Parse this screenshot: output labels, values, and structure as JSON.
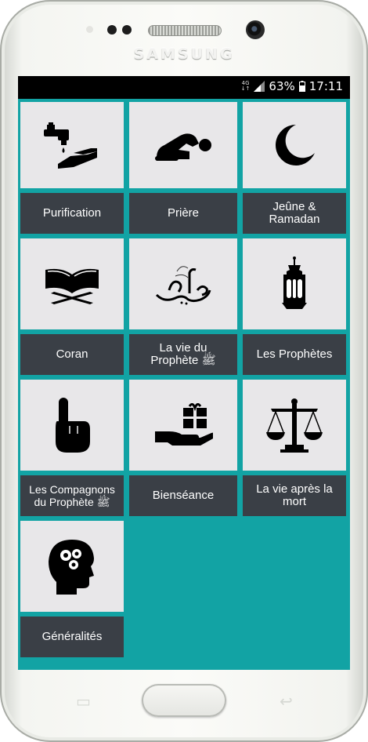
{
  "device": {
    "brand": "SAMSUNG"
  },
  "statusbar": {
    "network": "4G",
    "battery": "63%",
    "time": "17:11"
  },
  "categories": [
    {
      "label_lines": [
        "Purification"
      ],
      "icon": "water-hands-icon"
    },
    {
      "label_lines": [
        "Prière"
      ],
      "icon": "prostration-icon"
    },
    {
      "label_lines": [
        "Jeûne &",
        "Ramadan"
      ],
      "icon": "crescent-moon-icon"
    },
    {
      "label_lines": [
        "Coran"
      ],
      "icon": "quran-book-icon"
    },
    {
      "label_lines": [
        "La vie du",
        "Prophète ﷺ"
      ],
      "icon": "muhammad-calligraphy-icon"
    },
    {
      "label_lines": [
        "Les Prophètes"
      ],
      "icon": "lantern-icon"
    },
    {
      "label_lines": [
        "Les Compagnons",
        "du Prophète ﷺ"
      ],
      "icon": "raised-finger-icon"
    },
    {
      "label_lines": [
        "Bienséance"
      ],
      "icon": "gift-hand-icon"
    },
    {
      "label_lines": [
        "La vie après la",
        "mort"
      ],
      "icon": "scales-icon"
    },
    {
      "label_lines": [
        "Généralités"
      ],
      "icon": "head-gears-icon"
    }
  ],
  "colors": {
    "background": "#12a3a4",
    "tile": "#e8e7e9",
    "label_bar": "#3a3f46",
    "label_text": "#ffffff"
  }
}
